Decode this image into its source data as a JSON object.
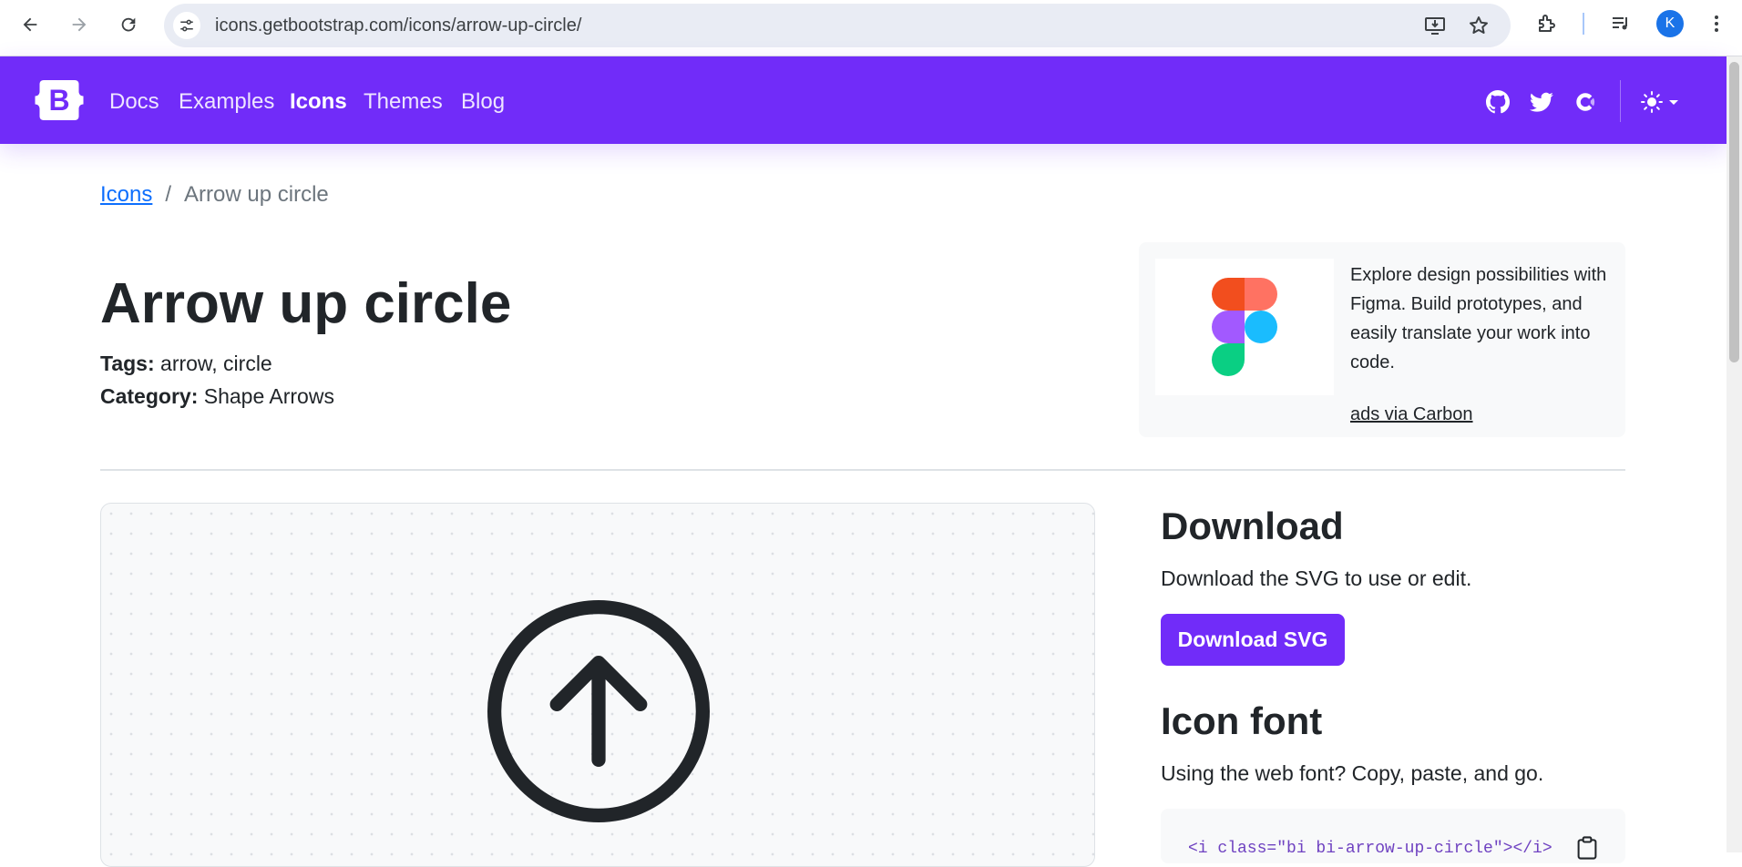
{
  "browser": {
    "url": "icons.getbootstrap.com/icons/arrow-up-circle/",
    "avatar_letter": "K",
    "icons": [
      "back-icon",
      "forward-icon",
      "reload-icon",
      "site-info-icon",
      "install-app-icon",
      "bookmark-star-icon",
      "extensions-icon",
      "media-playlist-icon",
      "more-vert-icon"
    ]
  },
  "navbar": {
    "brand_letter": "B",
    "links": [
      {
        "label": "Docs"
      },
      {
        "label": "Examples"
      },
      {
        "label": "Icons"
      },
      {
        "label": "Themes"
      },
      {
        "label": "Blog"
      }
    ],
    "active_link": "Icons",
    "icons": [
      "github-icon",
      "twitter-icon",
      "opencollective-icon",
      "theme-sun-icon",
      "caret-down-icon"
    ],
    "color": "#712cf9"
  },
  "breadcrumb": {
    "root": "Icons",
    "separator": "/",
    "current": "Arrow up circle"
  },
  "page": {
    "title": "Arrow up circle",
    "tags_label": "Tags:",
    "tags_value": "arrow, circle",
    "category_label": "Category:",
    "category_value": "Shape Arrows"
  },
  "ad": {
    "text": "Explore design possibilities with Figma. Build prototypes, and easily translate your work into code.",
    "via": "ads via Carbon",
    "logo": "figma-logo"
  },
  "download": {
    "heading": "Download",
    "lead": "Download the SVG to use or edit.",
    "button": "Download SVG"
  },
  "icon_font": {
    "heading": "Icon font",
    "lead": "Using the web font? Copy, paste, and go.",
    "code": "<i class=\"bi bi-arrow-up-circle\"></i>"
  },
  "preview": {
    "icon": "arrow-up-circle-icon"
  }
}
